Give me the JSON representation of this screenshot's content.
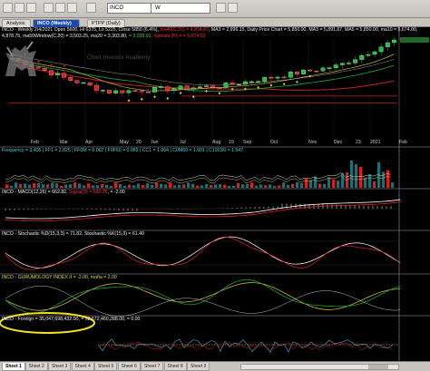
{
  "toolbar": {
    "symbol": "INCO",
    "interval": "W"
  },
  "tabs": [
    {
      "label": "Analysis",
      "active": false
    },
    {
      "label": "INCO (Weekly)",
      "active": true
    },
    {
      "label": "PTPP (Daily)",
      "active": false
    }
  ],
  "price_pane": {
    "title_prefix": "INCO - Weekly 2/4/2021 Open 5600, Hi 6375, Lo 5225, Close 5850 (6.4%)",
    "title_ma1": "ma40(C,20) = 4,894.87",
    "title_ma2": "MA3 = 2,996.15, Daily Price Chart = 5,850.00, MA3 = 5,891.67, MA5 = 5,850.00, ma10 = 5,674.00,",
    "line2_prefix": "4,878.75, ma50Window(C,20) = 3,503.25, ma20 = 3,303.80,",
    "line2_mid": "= 3,039.91,",
    "line2_suffix": "outlows 3% =  = 5,674.50",
    "watermark": "Chart Investor Academy",
    "x_labels": [
      "Feb",
      "Mar",
      "Apr",
      "May",
      "20",
      "Jun",
      "Jul",
      "Aug",
      "19",
      "Sep",
      "Oct",
      "Nov",
      "Dec",
      "23",
      "2021",
      "Feb"
    ]
  },
  "freq_pane": {
    "title": "Frequency = 3,405 | FF1 = 2,825 | FF0M = 0.062 | F0F60 = 0.089 | CC1 = 1.064 | C0M60 = 1.601 | C10C60 = 1.547"
  },
  "macd_pane": {
    "title": "INCO - MACD(12,26) = 662.82,",
    "signal": "Signal(9) = 590.35",
    "extra": ",  = -2.00"
  },
  "stoch_pane": {
    "title": "INCO - Stochastic %D(15,3,3) = 71.82, Stochastic %K(15,3) = 61.40"
  },
  "guru_pane": {
    "title": "INCO - GURUMOLOGY INDEX II = -2.00,  maña = 2.00"
  },
  "foreign_pane": {
    "title": "INCO - Foreign = 35,047,698,432.00",
    "rest": ",  = 53,672,460,288.00,  = 0.00"
  },
  "sheets": [
    "Sheet 1",
    "Sheet 2",
    "Sheet 3",
    "Sheet 4",
    "Sheet 5",
    "Sheet 6",
    "Sheet 7",
    "Sheet 8",
    "Sheet 9"
  ],
  "colors": {
    "up": "#22c03a",
    "down": "#e51a1a",
    "ma_red": "#c62020",
    "ma_green": "#1ea839",
    "ma_yellow": "#d8d040",
    "highlight": "#f0e01c"
  }
}
